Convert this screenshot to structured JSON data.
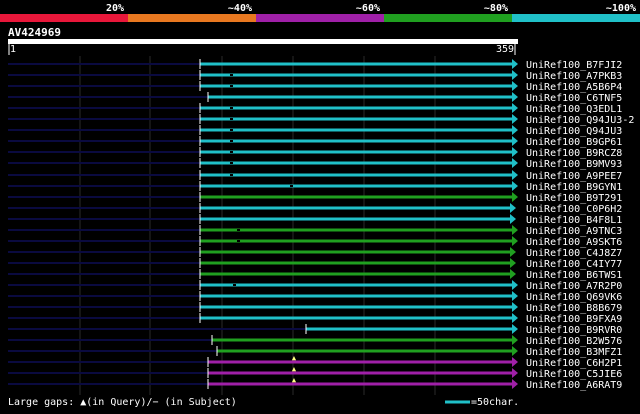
{
  "colors": {
    "background": "#000000",
    "text": "#ffffff",
    "grid": "#2a2a2a",
    "prefix_line": "#0a0a40",
    "query_axis_bg": "#ffffff",
    "red": "#e8173a",
    "orange": "#e87820",
    "purple": "#a020a8",
    "green": "#20a020",
    "cyan": "#20c0c8"
  },
  "legend": {
    "labels": [
      "20%",
      "~40%",
      "~60%",
      "~80%",
      "~100%"
    ],
    "colors": [
      "#e8173a",
      "#e87820",
      "#a020a8",
      "#20a020",
      "#20c0c8"
    ]
  },
  "query": {
    "id": "AV424969",
    "start": "1",
    "end": "359"
  },
  "hits": [
    {
      "id": "UniRef100_B7FJI2",
      "color": "cyan",
      "start": 200,
      "mark": null
    },
    {
      "id": "UniRef100_A7PKB3",
      "color": "cyan",
      "start": 200,
      "mark": 230
    },
    {
      "id": "UniRef100_A5B6P4",
      "color": "cyan",
      "start": 200,
      "mark": 230
    },
    {
      "id": "UniRef100_C6TNF5",
      "color": "cyan",
      "start": 208,
      "mark": null
    },
    {
      "id": "UniRef100_Q3EDL1",
      "color": "cyan",
      "start": 200,
      "mark": 230
    },
    {
      "id": "UniRef100_Q94JU3-2",
      "color": "cyan",
      "start": 200,
      "mark": 230
    },
    {
      "id": "UniRef100_Q94JU3",
      "color": "cyan",
      "start": 200,
      "mark": 230
    },
    {
      "id": "UniRef100_B9GP61",
      "color": "cyan",
      "start": 200,
      "mark": 230
    },
    {
      "id": "UniRef100_B9RCZ8",
      "color": "cyan",
      "start": 200,
      "mark": 230
    },
    {
      "id": "UniRef100_B9MV93",
      "color": "cyan",
      "start": 200,
      "mark": 230
    },
    {
      "id": "UniRef100_A9PEE7",
      "color": "cyan",
      "start": 200,
      "mark": 230
    },
    {
      "id": "UniRef100_B9GYN1",
      "color": "cyan",
      "start": 200,
      "mark": 290
    },
    {
      "id": "UniRef100_B9T291",
      "color": "green",
      "start": 200,
      "mark": null
    },
    {
      "id": "UniRef100_C0P6H2",
      "color": "cyan",
      "start": 200,
      "end": 510,
      "mark": null
    },
    {
      "id": "UniRef100_B4F8L1",
      "color": "cyan",
      "start": 200,
      "end": 510,
      "mark": null
    },
    {
      "id": "UniRef100_A9TNC3",
      "color": "green",
      "start": 200,
      "mark": 237
    },
    {
      "id": "UniRef100_A9SKT6",
      "color": "green",
      "start": 200,
      "mark": 237
    },
    {
      "id": "UniRef100_C4J8Z7",
      "color": "green",
      "start": 200,
      "end": 510,
      "mark": null
    },
    {
      "id": "UniRef100_C4IY77",
      "color": "green",
      "start": 200,
      "end": 510,
      "mark": null
    },
    {
      "id": "UniRef100_B6TWS1",
      "color": "green",
      "start": 200,
      "end": 510,
      "mark": null
    },
    {
      "id": "UniRef100_A7R2P0",
      "color": "cyan",
      "start": 200,
      "mark": 233
    },
    {
      "id": "UniRef100_Q69VK6",
      "color": "cyan",
      "start": 200,
      "mark": null
    },
    {
      "id": "UniRef100_B8B679",
      "color": "cyan",
      "start": 200,
      "mark": null
    },
    {
      "id": "UniRef100_B9FXA9",
      "color": "cyan",
      "start": 200,
      "mark": null
    },
    {
      "id": "UniRef100_B9RVR0",
      "color": "cyan",
      "start": 306,
      "mark": null
    },
    {
      "id": "UniRef100_B2W576",
      "color": "green",
      "start": 212,
      "mark": null
    },
    {
      "id": "UniRef100_B3MFZ1",
      "color": "green",
      "start": 217,
      "mark": null
    },
    {
      "id": "UniRef100_C6H2P1",
      "color": "purple",
      "start": 208,
      "mark": null,
      "gap_q": 294
    },
    {
      "id": "UniRef100_C5JIE6",
      "color": "purple",
      "start": 208,
      "mark": null,
      "gap_q": 294
    },
    {
      "id": "UniRef100_A6RAT9",
      "color": "purple",
      "start": 208,
      "mark": null,
      "gap_q": 294
    }
  ],
  "footer": {
    "gaps_text": "Large gaps: ▲(in Query)/− (in Subject)",
    "scale_text": "=50char."
  }
}
